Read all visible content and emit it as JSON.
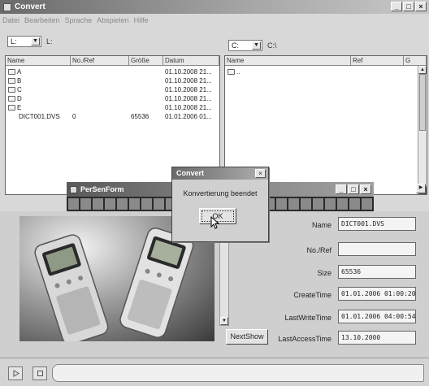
{
  "window": {
    "title": "Convert",
    "minimize": "_",
    "maximize": "□",
    "close": "×"
  },
  "menu": [
    "Datei",
    "Bearbeiten",
    "Sprache",
    "Abspielen",
    "Hilfe"
  ],
  "left": {
    "drive": "L:",
    "path": "L:",
    "columns": [
      "Name",
      "No./Ref",
      "Größe",
      "Datum"
    ],
    "rows": [
      {
        "name": "A",
        "ref": "",
        "size": "",
        "date": "01.10.2008 21...",
        "folder": true
      },
      {
        "name": "B",
        "ref": "",
        "size": "",
        "date": "01.10.2008 21...",
        "folder": true
      },
      {
        "name": "C",
        "ref": "",
        "size": "",
        "date": "01.10.2008 21...",
        "folder": true
      },
      {
        "name": "D",
        "ref": "",
        "size": "",
        "date": "01.10.2008 21...",
        "folder": true
      },
      {
        "name": "E",
        "ref": "",
        "size": "",
        "date": "01.10.2008 21...",
        "folder": true
      },
      {
        "name": "DICT001.DVS",
        "ref": "0",
        "size": "65536",
        "date": "01.01.2006 01...",
        "folder": false
      }
    ]
  },
  "right": {
    "drive": "C:",
    "path": "C:\\",
    "columns": [
      "Name",
      "Ref",
      "G"
    ],
    "rows": [
      {
        "name": "..",
        "folder": true
      }
    ]
  },
  "perserform": {
    "title": "PerSenForm",
    "minimize": "_",
    "maximize": "□",
    "close": "×"
  },
  "dialog": {
    "title": "Convert",
    "close": "×",
    "message": "Konvertierung beendet",
    "ok": "OK"
  },
  "details": {
    "fields": [
      {
        "label": "Name",
        "value": "DICT001.DVS"
      },
      {
        "label": "No./Ref",
        "value": ""
      },
      {
        "label": "Size",
        "value": "65536"
      },
      {
        "label": "CreateTime",
        "value": "01.01.2006 01:00:20"
      },
      {
        "label": "LastWriteTime",
        "value": "01.01.2006 04:00:54"
      },
      {
        "label": "LastAccessTime",
        "value": "13.10.2000"
      }
    ],
    "next_button": "NextShow"
  }
}
